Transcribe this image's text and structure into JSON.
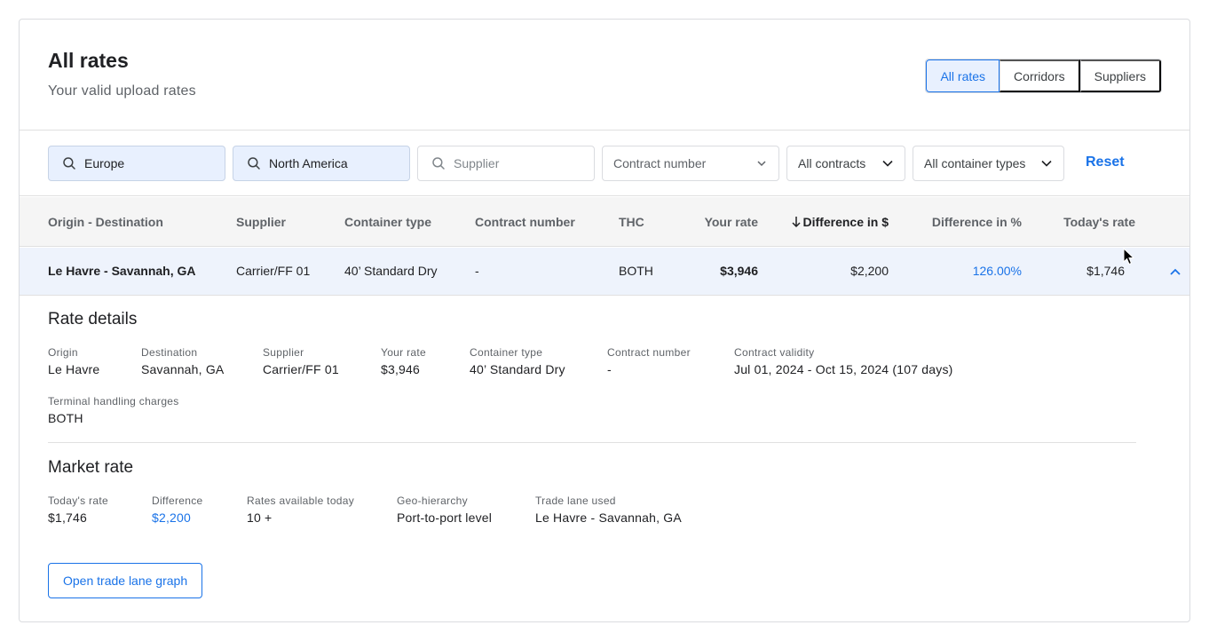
{
  "header": {
    "title": "All rates",
    "subtitle": "Your valid upload rates",
    "tabs": [
      {
        "label": "All rates"
      },
      {
        "label": "Corridors"
      },
      {
        "label": "Suppliers"
      }
    ]
  },
  "filters": {
    "origin_value": "Europe",
    "destination_value": "North America",
    "supplier_placeholder": "Supplier",
    "contract_number_placeholder": "Contract number",
    "contracts_select": "All contracts",
    "container_types_select": "All container types",
    "reset_label": "Reset"
  },
  "table": {
    "columns": {
      "origin_destination": "Origin - Destination",
      "supplier": "Supplier",
      "container_type": "Container type",
      "contract_number": "Contract number",
      "thc": "THC",
      "your_rate": "Your rate",
      "difference_usd": "Difference in $",
      "difference_pct": "Difference in %",
      "todays_rate": "Today's rate"
    },
    "row": {
      "origin_destination": "Le Havre - Savannah, GA",
      "supplier": "Carrier/FF 01",
      "container_type": "40’ Standard Dry",
      "contract_number": "-",
      "thc": "BOTH",
      "your_rate": "$3,946",
      "difference_usd": "$2,200",
      "difference_pct": "126.00%",
      "todays_rate": "$1,746"
    }
  },
  "rate_details": {
    "title": "Rate details",
    "fields": [
      {
        "label": "Origin",
        "value": "Le Havre"
      },
      {
        "label": "Destination",
        "value": "Savannah, GA"
      },
      {
        "label": "Supplier",
        "value": "Carrier/FF 01"
      },
      {
        "label": "Your rate",
        "value": "$3,946"
      },
      {
        "label": "Container type",
        "value": "40’ Standard Dry"
      },
      {
        "label": "Contract number",
        "value": "-"
      },
      {
        "label": "Contract validity",
        "value": "Jul 01, 2024 - Oct 15, 2024 (107 days)"
      },
      {
        "label": "Terminal handling charges",
        "value": "BOTH"
      }
    ]
  },
  "market_rate": {
    "title": "Market rate",
    "fields": [
      {
        "label": "Today's rate",
        "value": "$1,746"
      },
      {
        "label": "Difference",
        "value": "$2,200"
      },
      {
        "label": "Rates available today",
        "value": "10 +"
      },
      {
        "label": "Geo-hierarchy",
        "value": "Port-to-port level"
      },
      {
        "label": "Trade lane used",
        "value": "Le Havre - Savannah, GA"
      }
    ],
    "button_label": "Open trade lane graph"
  },
  "colors": {
    "accent": "#1a73e8",
    "row_highlight": "#eef3fc",
    "header_bg": "#f5f5f5"
  }
}
